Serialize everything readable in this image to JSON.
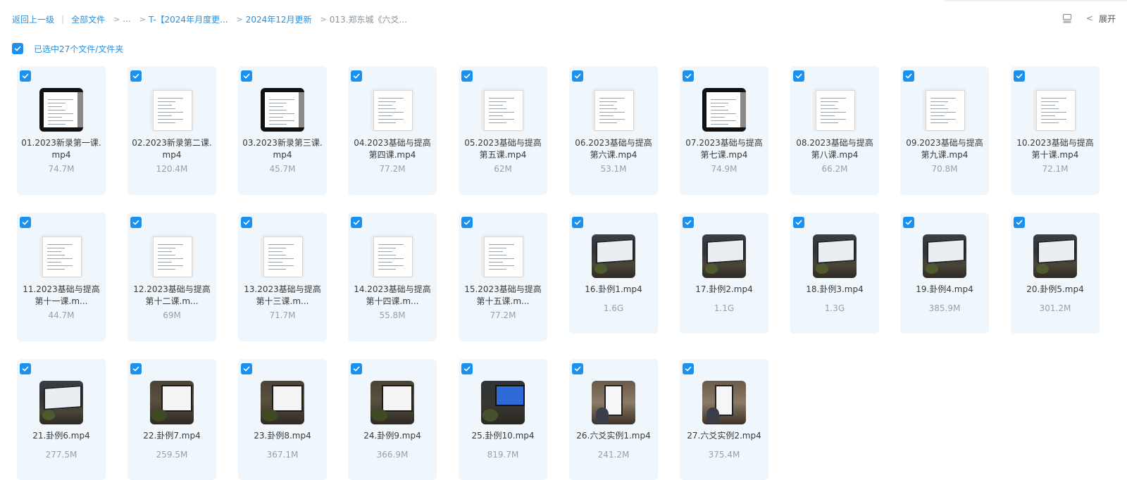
{
  "breadcrumb": {
    "back": "返回上一级",
    "all_files": "全部文件",
    "ellipsis": "...",
    "level1": "T-【2024年月度更...",
    "level2": "2024年12月更新",
    "current": "013.郑东城《六爻..."
  },
  "toolbar": {
    "expand_label": "展开",
    "list_view_icon": "list-view-icon",
    "chevron_icon": "chevron-left-icon"
  },
  "selection": {
    "label": "已选中27个文件/文件夹"
  },
  "colors": {
    "accent": "#1a90ef",
    "card_bg": "#f0f7fc",
    "link": "#2b8fdc"
  },
  "files": [
    {
      "name": "01.2023新录第一课.mp4",
      "size": "74.7M",
      "thumb": "doc-dark"
    },
    {
      "name": "02.2023新录第二课.mp4",
      "size": "120.4M",
      "thumb": "doc"
    },
    {
      "name": "03.2023新录第三课.mp4",
      "size": "45.7M",
      "thumb": "doc-dark"
    },
    {
      "name": "04.2023基础与提高第四课.mp4",
      "size": "77.2M",
      "thumb": "doc"
    },
    {
      "name": "05.2023基础与提高第五课.mp4",
      "size": "62M",
      "thumb": "doc"
    },
    {
      "name": "06.2023基础与提高第六课.mp4",
      "size": "53.1M",
      "thumb": "doc"
    },
    {
      "name": "07.2023基础与提高第七课.mp4",
      "size": "74.9M",
      "thumb": "doc-dark"
    },
    {
      "name": "08.2023基础与提高第八课.mp4",
      "size": "66.2M",
      "thumb": "doc"
    },
    {
      "name": "09.2023基础与提高第九课.mp4",
      "size": "70.8M",
      "thumb": "doc"
    },
    {
      "name": "10.2023基础与提高第十课.mp4",
      "size": "72.1M",
      "thumb": "doc"
    },
    {
      "name": "11.2023基础与提高第十一课.m...",
      "size": "44.7M",
      "thumb": "doc"
    },
    {
      "name": "12.2023基础与提高第十二课.m...",
      "size": "69M",
      "thumb": "doc"
    },
    {
      "name": "13.2023基础与提高第十三课.m...",
      "size": "71.7M",
      "thumb": "doc"
    },
    {
      "name": "14.2023基础与提高第十四课.m...",
      "size": "55.8M",
      "thumb": "doc"
    },
    {
      "name": "15.2023基础与提高第十五课.m...",
      "size": "77.2M",
      "thumb": "doc"
    },
    {
      "name": "16.卦例1.mp4",
      "size": "1.6G",
      "thumb": "photo"
    },
    {
      "name": "17.卦例2.mp4",
      "size": "1.1G",
      "thumb": "photo"
    },
    {
      "name": "18.卦例3.mp4",
      "size": "1.3G",
      "thumb": "photo"
    },
    {
      "name": "19.卦例4.mp4",
      "size": "385.9M",
      "thumb": "photo"
    },
    {
      "name": "20.卦例5.mp4",
      "size": "301.2M",
      "thumb": "photo"
    },
    {
      "name": "21.卦例6.mp4",
      "size": "277.5M",
      "thumb": "photo"
    },
    {
      "name": "22.卦例7.mp4",
      "size": "259.5M",
      "thumb": "photo2"
    },
    {
      "name": "23.卦例8.mp4",
      "size": "367.1M",
      "thumb": "photo2"
    },
    {
      "name": "24.卦例9.mp4",
      "size": "366.9M",
      "thumb": "photo2"
    },
    {
      "name": "25.卦例10.mp4",
      "size": "819.7M",
      "thumb": "photo-blue"
    },
    {
      "name": "26.六爻实例1.mp4",
      "size": "241.2M",
      "thumb": "photo3"
    },
    {
      "name": "27.六爻实例2.mp4",
      "size": "375.4M",
      "thumb": "photo3"
    }
  ]
}
